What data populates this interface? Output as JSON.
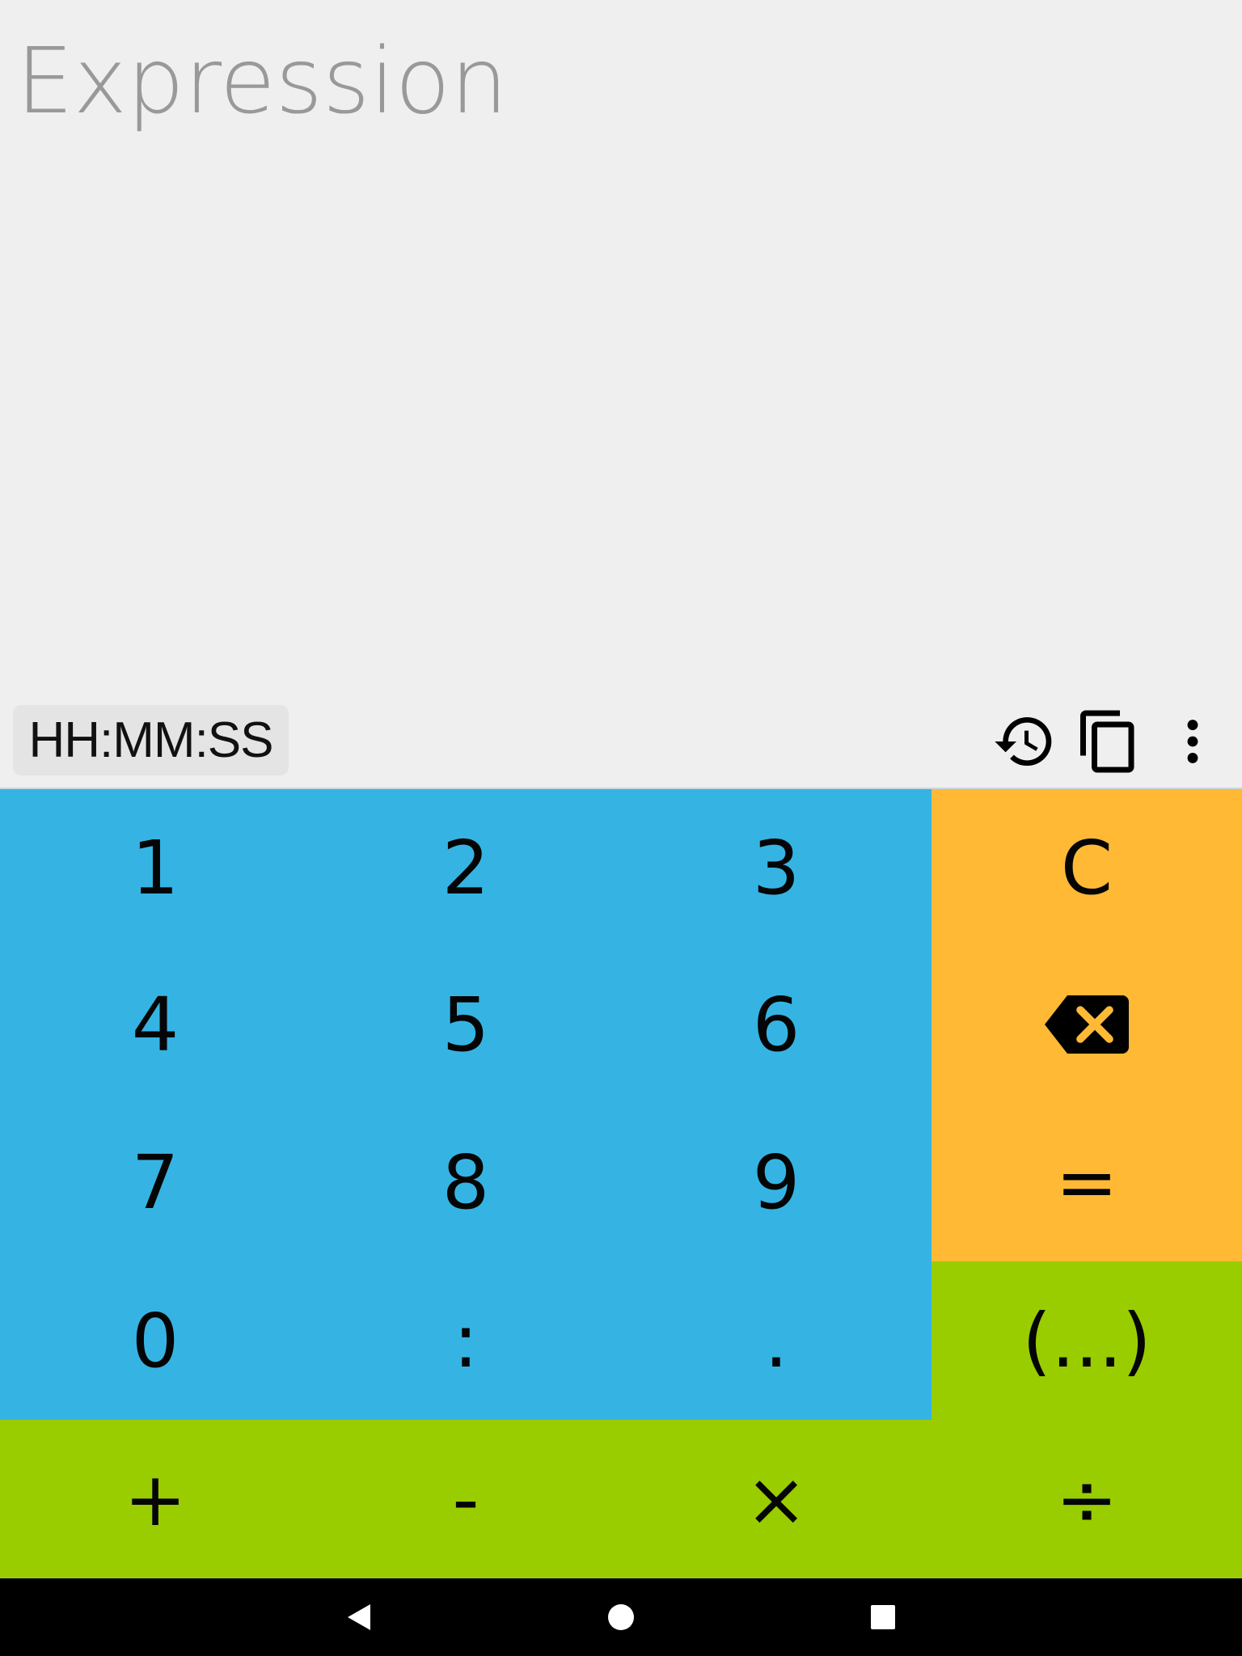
{
  "display": {
    "expression_value": "",
    "expression_placeholder": "Expression",
    "mode_label": "HH:MM:SS"
  },
  "toolbar": {
    "icons": [
      "history-icon",
      "copy-icon",
      "more-vert-icon"
    ]
  },
  "keypad": {
    "row1": [
      "1",
      "2",
      "3",
      "C"
    ],
    "row2": [
      "4",
      "5",
      "6",
      "backspace-icon"
    ],
    "row3": [
      "7",
      "8",
      "9",
      "="
    ],
    "row4": [
      "0",
      ":",
      ".",
      "(...)"
    ],
    "row5": [
      "+",
      "-",
      "×",
      "÷"
    ]
  },
  "navbar": {
    "icons": [
      "back-icon",
      "home-icon",
      "recents-icon"
    ]
  },
  "colors": {
    "background": "#efefef",
    "digits": "#35b4e4",
    "control": "#ffb935",
    "operators": "#99cd00",
    "navbar": "#000000"
  }
}
